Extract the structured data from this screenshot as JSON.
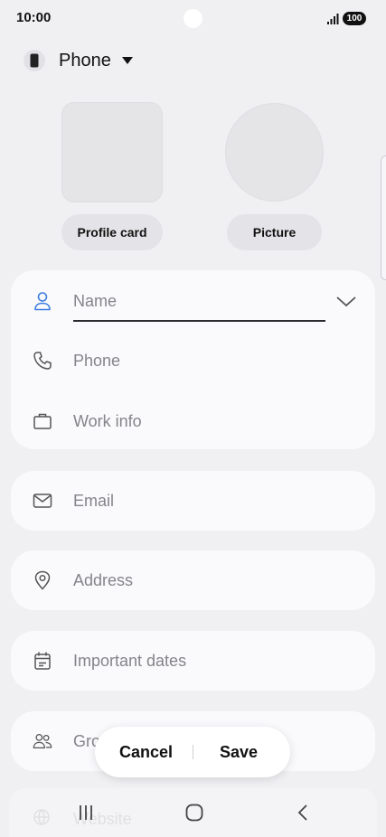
{
  "status_bar": {
    "time": "10:00",
    "battery": "100"
  },
  "account": {
    "label": "Phone"
  },
  "profile": {
    "profile_card_label": "Profile card",
    "picture_label": "Picture"
  },
  "fields": {
    "name_placeholder": "Name",
    "phone_placeholder": "Phone",
    "work_info_label": "Work info",
    "email_placeholder": "Email",
    "address_placeholder": "Address",
    "important_dates_label": "Important dates",
    "groups_label_partial": "Gro",
    "website_label_faded": "Website"
  },
  "actions": {
    "cancel_label": "Cancel",
    "save_label": "Save"
  },
  "colors": {
    "accent": "#3a7be0",
    "background": "#f0f0f3",
    "card": "#fafafd",
    "placeholder": "#858589"
  },
  "icons": [
    "person-icon",
    "phone-icon",
    "briefcase-icon",
    "mail-icon",
    "location-pin-icon",
    "calendar-icon",
    "group-icon",
    "globe-icon",
    "chevron-down-icon",
    "nav-recents-icon",
    "nav-home-icon",
    "nav-back-icon"
  ]
}
